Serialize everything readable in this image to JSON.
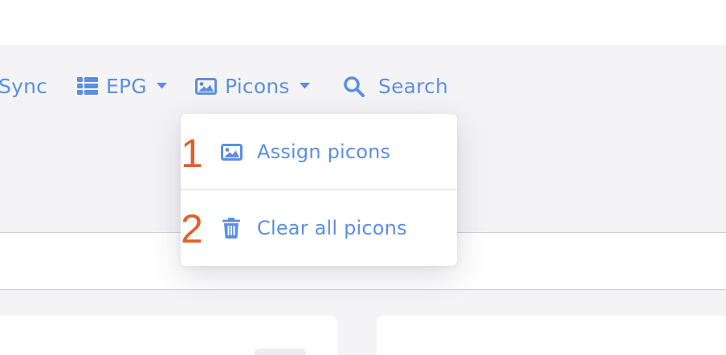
{
  "navbar": {
    "sync_label": "Sync",
    "epg_label": "EPG",
    "picons_label": "Picons",
    "search_label": "Search"
  },
  "picons_menu": {
    "items": [
      {
        "number": "1",
        "label": "Assign picons",
        "icon": "image-icon"
      },
      {
        "number": "2",
        "label": "Clear all picons",
        "icon": "trash-icon"
      }
    ]
  },
  "content": {
    "partial_heading": "...(cut off)"
  },
  "colors": {
    "accent": "#5d8fe0",
    "annotation": "#e0612a",
    "background": "#f4f4f7"
  }
}
